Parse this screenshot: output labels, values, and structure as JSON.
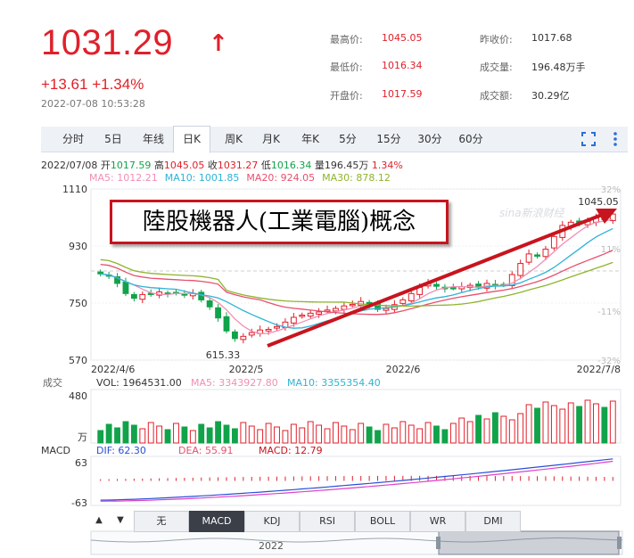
{
  "quote": {
    "price": "1031.29",
    "change": "+13.61 +1.34%",
    "timestamp": "2022-07-08 10:53:28",
    "stats": [
      {
        "label": "最高价:",
        "value": "1045.05",
        "color": "red"
      },
      {
        "label": "昨收价:",
        "value": "1017.68",
        "color": "dark"
      },
      {
        "label": "最低价:",
        "value": "1016.34",
        "color": "red"
      },
      {
        "label": "成交量:",
        "value": "196.48万手",
        "color": "dark"
      },
      {
        "label": "开盘价:",
        "value": "1017.59",
        "color": "red"
      },
      {
        "label": "成交额:",
        "value": "30.29亿",
        "color": "dark"
      }
    ]
  },
  "tabs": [
    "分时",
    "5日",
    "年线",
    "日K",
    "周K",
    "月K",
    "年K",
    "5分",
    "15分",
    "30分",
    "60分"
  ],
  "active_tab": "日K",
  "info": {
    "date": "2022/07/08",
    "open_label": "开",
    "open": "1017.59",
    "high_label": "高",
    "high": "1045.05",
    "close_label": "收",
    "close": "1031.27",
    "low_label": "低",
    "low": "1016.34",
    "vol_label": "量",
    "vol": "196.45万",
    "pct": "1.34%"
  },
  "ma_legend": [
    {
      "text": "MA5: 1012.21",
      "color": "#f08fb4"
    },
    {
      "text": "MA10: 1001.85",
      "color": "#2eb3d6"
    },
    {
      "text": "MA20: 924.05",
      "color": "#e8506e"
    },
    {
      "text": "MA30: 878.12",
      "color": "#8fb42c"
    }
  ],
  "annotation": "陸股機器人(工業電腦)概念",
  "watermark": "sina新浪财经",
  "volume_legend": {
    "label": "成交",
    "vol": "VOL: 1964531.00",
    "ma5": "MA5: 3343927.80",
    "ma10": "MA10: 3355354.40"
  },
  "macd_legend": {
    "label": "MACD",
    "dif": "DIF: 62.30",
    "dea": "DEA: 55.91",
    "macd": "MACD: 12.79"
  },
  "bottom_tabs": [
    "无",
    "MACD",
    "KDJ",
    "RSI",
    "BOLL",
    "WR",
    "DMI"
  ],
  "active_bottom_tab": "MACD",
  "navigator_label": "2022",
  "colors": {
    "up": "#e0202a",
    "down": "#11a34a",
    "accent": "#2a6fd6"
  },
  "chart_data": {
    "type": "candlestick",
    "price_axis": {
      "ylim": [
        570,
        1110
      ],
      "ticks": [
        "1110",
        "930",
        "750",
        "570"
      ]
    },
    "pct_axis": [
      "32%",
      "11%",
      "-11%",
      "-32%"
    ],
    "date_labels": [
      "2022/4/6",
      "2022/5",
      "2022/6",
      "2022/7/8"
    ],
    "low_annotation": "615.33",
    "high_annotation": "1045.05",
    "volume_axis": {
      "top": "480",
      "unit": "万"
    },
    "macd_axis": {
      "top": "63",
      "bottom": "-63",
      "ylim": [
        -70,
        70
      ]
    },
    "closes": [
      842,
      836,
      812,
      780,
      765,
      777,
      778,
      785,
      780,
      782,
      776,
      780,
      760,
      738,
      703,
      662,
      638,
      645,
      657,
      665,
      667,
      676,
      690,
      705,
      712,
      718,
      722,
      728,
      733,
      741,
      746,
      755,
      745,
      730,
      733,
      745,
      760,
      780,
      800,
      812,
      803,
      795,
      798,
      802,
      806,
      800,
      812,
      805,
      808,
      840,
      875,
      905,
      900,
      920,
      960,
      995,
      1005,
      1000,
      1008,
      1018,
      1013,
      1031
    ]
  }
}
